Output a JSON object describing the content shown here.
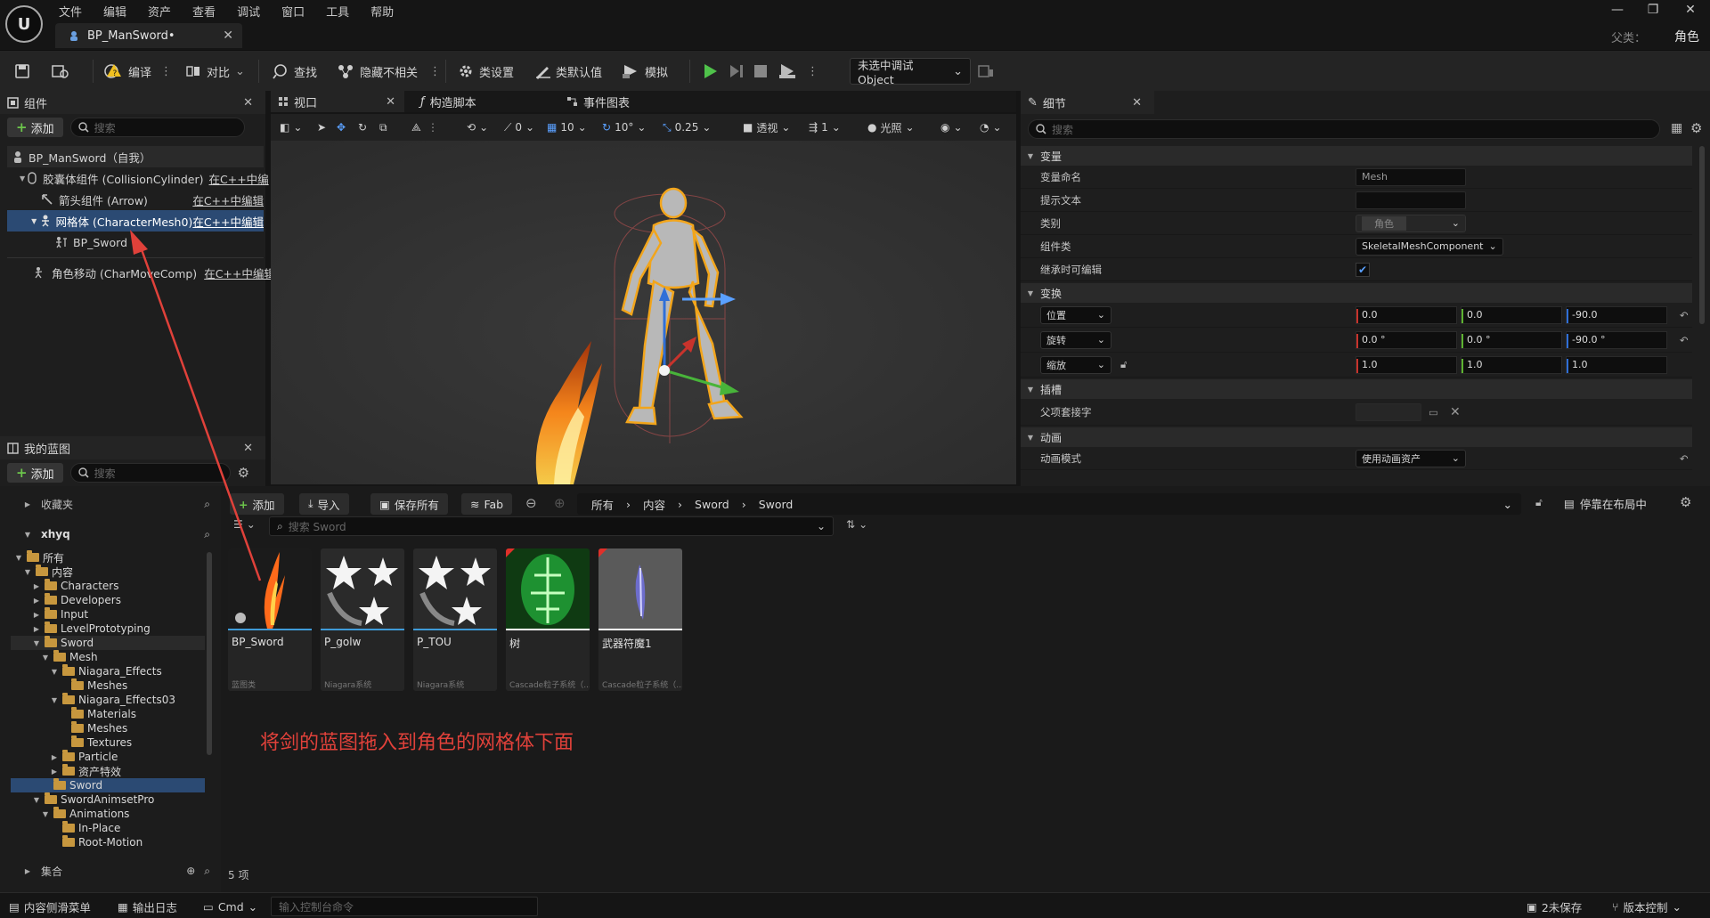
{
  "window": {
    "menu": [
      "文件",
      "编辑",
      "资产",
      "查看",
      "调试",
      "窗口",
      "工具",
      "帮助"
    ],
    "tab_title": "BP_ManSword•",
    "parent_label": "父类：",
    "parent_value": "角色"
  },
  "toolbar": {
    "compile": "编译",
    "diff": "对比",
    "find": "查找",
    "hide_unrelated": "隐藏不相关",
    "class_settings": "类设置",
    "class_defaults": "类默认值",
    "simulate": "模拟",
    "debug_object": "未选中调试Object"
  },
  "components": {
    "tab": "组件",
    "add": "添加",
    "search_placeholder": "搜索",
    "items": [
      {
        "label": "BP_ManSword（自我）",
        "link": ""
      },
      {
        "label": "胶囊体组件 (CollisionCylinder)",
        "link": "在C++中编"
      },
      {
        "label": "箭头组件 (Arrow)",
        "link": "在C++中编辑"
      },
      {
        "label": "网格体 (CharacterMesh0)",
        "link": "在C++中编辑"
      },
      {
        "label": "BP_Sword",
        "link": ""
      },
      {
        "label": "角色移动 (CharMoveComp)",
        "link": "在C++中编辑"
      }
    ]
  },
  "my_blueprint": {
    "tab": "我的蓝图",
    "add": "添加",
    "search_placeholder": "搜索"
  },
  "viewport": {
    "tabs": [
      "视口",
      "构造脚本",
      "事件图表"
    ],
    "tools": {
      "angle": "0",
      "grid": "10",
      "rot": "10°",
      "scale": "0.25",
      "perspective": "透视",
      "lighting": "光照",
      "speed": "1"
    }
  },
  "details": {
    "tab": "细节",
    "search_placeholder": "搜索",
    "sections": {
      "variable": "变量",
      "transform": "变换",
      "sockets": "插槽",
      "animation": "动画"
    },
    "props": {
      "var_name_label": "变量命名",
      "var_name_value": "Mesh",
      "tooltip_label": "提示文本",
      "category_label": "类别",
      "category_value": "角色",
      "component_class_label": "组件类",
      "component_class_value": "SkeletalMeshComponent",
      "editable_label": "继承时可编辑",
      "location_label": "位置",
      "rotation_label": "旋转",
      "scale_label": "缩放",
      "location": [
        "0.0",
        "0.0",
        "-90.0"
      ],
      "rotation": [
        "0.0 °",
        "0.0 °",
        "-90.0 °"
      ],
      "scale": [
        "1.0",
        "1.0",
        "1.0"
      ],
      "parent_socket_label": "父项套接字",
      "anim_mode_label": "动画模式",
      "anim_mode_value": "使用动画资产"
    }
  },
  "content_browser": {
    "favorites": "收藏夹",
    "user": "xhyq",
    "collections": "集合",
    "add": "添加",
    "import": "导入",
    "save_all": "保存所有",
    "fab": "Fab",
    "breadcrumb": [
      "所有",
      "内容",
      "Sword",
      "Sword"
    ],
    "dock_label": "停靠在布局中",
    "search_placeholder": "搜索 Sword",
    "tree": [
      {
        "label": "所有",
        "indent": 0,
        "open": true
      },
      {
        "label": "内容",
        "indent": 1,
        "open": true
      },
      {
        "label": "Characters",
        "indent": 2,
        "open": false
      },
      {
        "label": "Developers",
        "indent": 2,
        "open": false
      },
      {
        "label": "Input",
        "indent": 2,
        "open": false
      },
      {
        "label": "LevelPrototyping",
        "indent": 2,
        "open": false
      },
      {
        "label": "Sword",
        "indent": 2,
        "open": true
      },
      {
        "label": "Mesh",
        "indent": 3,
        "open": true
      },
      {
        "label": "Niagara_Effects",
        "indent": 4,
        "open": true
      },
      {
        "label": "Meshes",
        "indent": 5,
        "open": null
      },
      {
        "label": "Niagara_Effects03",
        "indent": 4,
        "open": true
      },
      {
        "label": "Materials",
        "indent": 5,
        "open": null
      },
      {
        "label": "Meshes",
        "indent": 5,
        "open": null
      },
      {
        "label": "Textures",
        "indent": 5,
        "open": null
      },
      {
        "label": "Particle",
        "indent": 4,
        "open": false
      },
      {
        "label": "资产特效",
        "indent": 4,
        "open": false
      },
      {
        "label": "Sword",
        "indent": 3,
        "open": null
      },
      {
        "label": "SwordAnimsetPro",
        "indent": 2,
        "open": true
      },
      {
        "label": "Animations",
        "indent": 3,
        "open": true
      },
      {
        "label": "In-Place",
        "indent": 4,
        "open": null
      },
      {
        "label": "Root-Motion",
        "indent": 4,
        "open": null
      }
    ],
    "assets": [
      {
        "name": "BP_Sword",
        "type": "蓝图类"
      },
      {
        "name": "P_golw",
        "type": "Niagara系统"
      },
      {
        "name": "P_TOU",
        "type": "Niagara系统"
      },
      {
        "name": "树",
        "type": "Cascade粒子系统（..."
      },
      {
        "name": "武器符魔1",
        "type": "Cascade粒子系统（..."
      }
    ],
    "item_count": "5 项",
    "annotation": "将剑的蓝图拖入到角色的网格体下面"
  },
  "statusbar": {
    "drawer": "内容侧滑菜单",
    "output_log": "输出日志",
    "cmd": "Cmd",
    "console_placeholder": "输入控制台命令",
    "unsaved": "2未保存",
    "source_control": "版本控制"
  },
  "colors": {
    "selection": "#2b4a73",
    "play_green": "#4fc24a",
    "annotation_red": "#e0413a",
    "niagara_bar": "#3f9bd8"
  }
}
